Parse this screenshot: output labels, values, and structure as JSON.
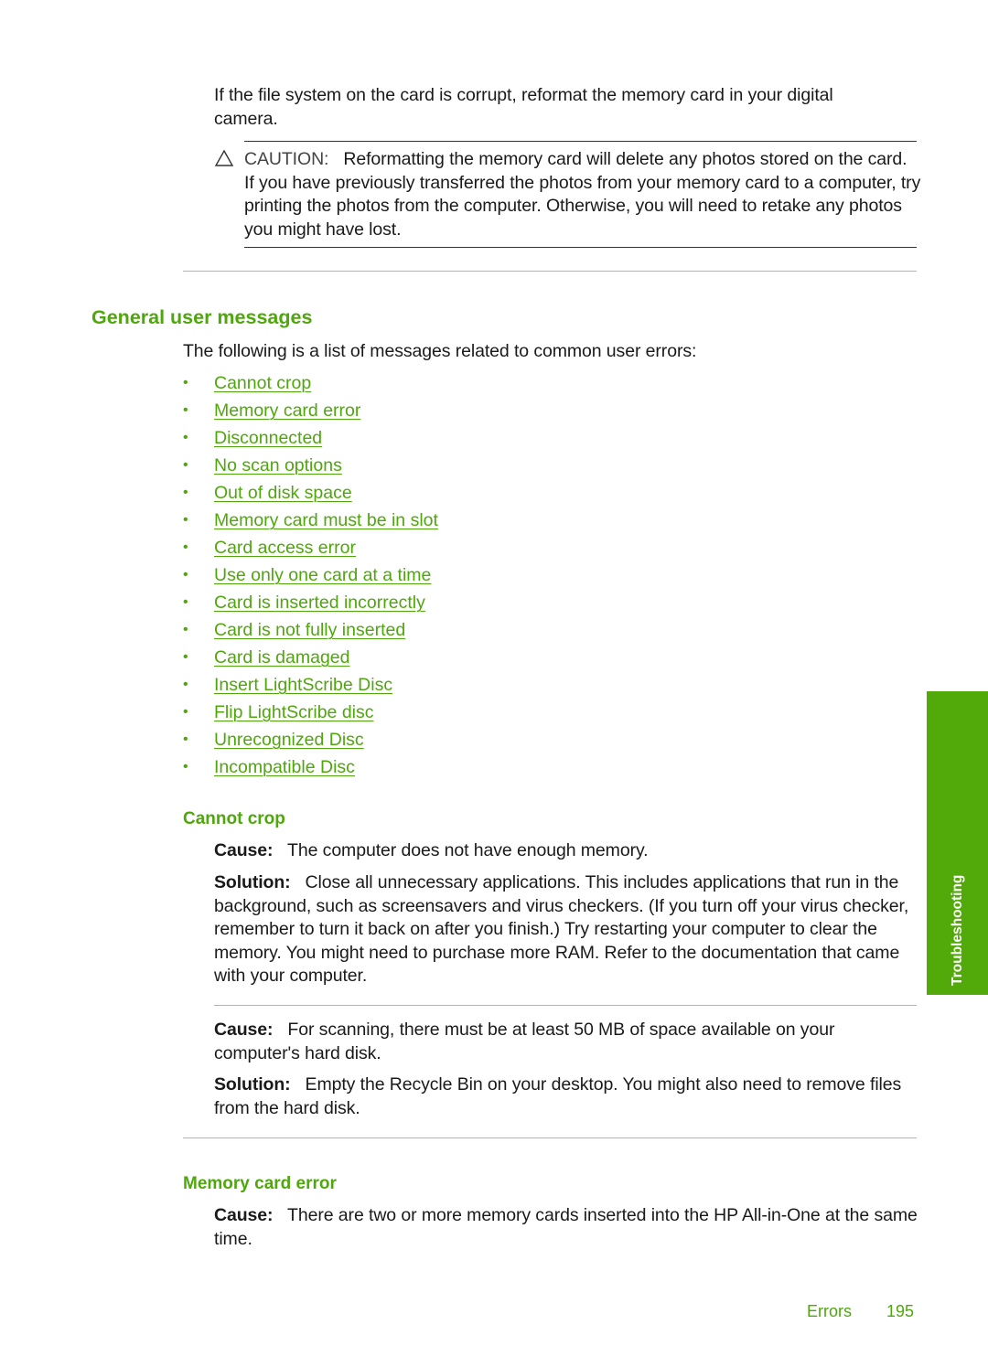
{
  "intro": {
    "text": "If the file system on the card is corrupt, reformat the memory card in your digital camera."
  },
  "caution": {
    "icon": "caution-triangle-icon",
    "label": "CAUTION:",
    "text": "Reformatting the memory card will delete any photos stored on the card. If you have previously transferred the photos from your memory card to a computer, try printing the photos from the computer. Otherwise, you will need to retake any photos you might have lost."
  },
  "general_messages": {
    "heading": "General user messages",
    "intro": "The following is a list of messages related to common user errors:",
    "links": [
      "Cannot crop",
      "Memory card error",
      "Disconnected",
      "No scan options",
      "Out of disk space",
      "Memory card must be in slot",
      "Card access error",
      "Use only one card at a time",
      "Card is inserted incorrectly",
      "Card is not fully inserted",
      "Card is damaged",
      "Insert LightScribe Disc",
      "Flip LightScribe disc",
      "Unrecognized Disc",
      "Incompatible Disc"
    ]
  },
  "cannot_crop": {
    "heading": "Cannot crop",
    "entries": [
      {
        "cause_label": "Cause:",
        "cause": "The computer does not have enough memory.",
        "solution_label": "Solution:",
        "solution": "Close all unnecessary applications. This includes applications that run in the background, such as screensavers and virus checkers. (If you turn off your virus checker, remember to turn it back on after you finish.) Try restarting your computer to clear the memory. You might need to purchase more RAM. Refer to the documentation that came with your computer."
      },
      {
        "cause_label": "Cause:",
        "cause": "For scanning, there must be at least 50 MB of space available on your computer's hard disk.",
        "solution_label": "Solution:",
        "solution": "Empty the Recycle Bin on your desktop. You might also need to remove files from the hard disk."
      }
    ]
  },
  "memory_card_error": {
    "heading": "Memory card error",
    "cause_label": "Cause:",
    "cause": "There are two or more memory cards inserted into the HP All-in-One at the same time."
  },
  "side_tab": {
    "label": "Troubleshooting"
  },
  "footer": {
    "section": "Errors",
    "page_number": "195"
  },
  "colors": {
    "accent_green": "#4ea70b",
    "tab_green": "#52a90a",
    "body_text": "#1a1a1a"
  }
}
